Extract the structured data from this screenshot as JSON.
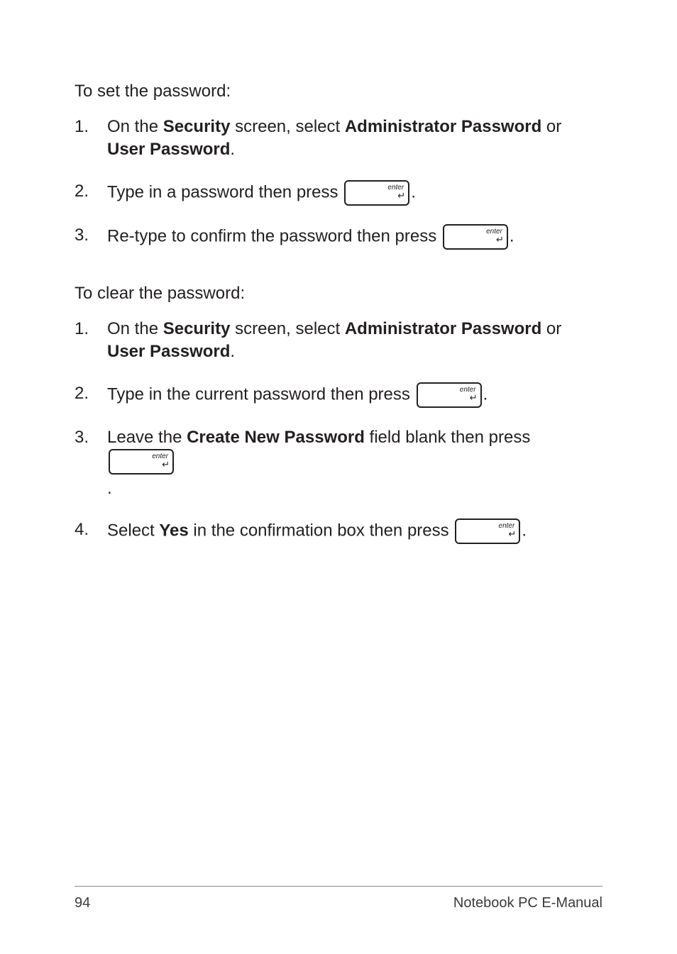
{
  "section1": {
    "heading": "To set the password:",
    "items": [
      {
        "num": "1.",
        "pre": "On the ",
        "b1": "Security",
        "mid1": " screen, select ",
        "b2": "Administrator Password",
        "mid2": " or ",
        "b3": "User Password",
        "post": "."
      },
      {
        "num": "2.",
        "pre": "Type in a password then press ",
        "post": "."
      },
      {
        "num": "3.",
        "pre": "Re-type to confirm the password then press ",
        "post": "."
      }
    ]
  },
  "section2": {
    "heading": "To clear the password:",
    "items": [
      {
        "num": "1.",
        "pre": "On the ",
        "b1": "Security",
        "mid1": " screen, select ",
        "b2": "Administrator Password",
        "mid2": " or ",
        "b3": "User Password",
        "post": "."
      },
      {
        "num": "2.",
        "pre": "Type in the current password then press ",
        "post": "."
      },
      {
        "num": "3.",
        "pre": "Leave the ",
        "b1": "Create New Password",
        "mid1": " field blank then press ",
        "post": " ."
      },
      {
        "num": "4.",
        "pre": "Select ",
        "b1": "Yes",
        "mid1": " in the confirmation box then press ",
        "post": "."
      }
    ]
  },
  "key": {
    "label": "enter",
    "arrow": "↵"
  },
  "footer": {
    "page": "94",
    "title": "Notebook PC E-Manual"
  }
}
